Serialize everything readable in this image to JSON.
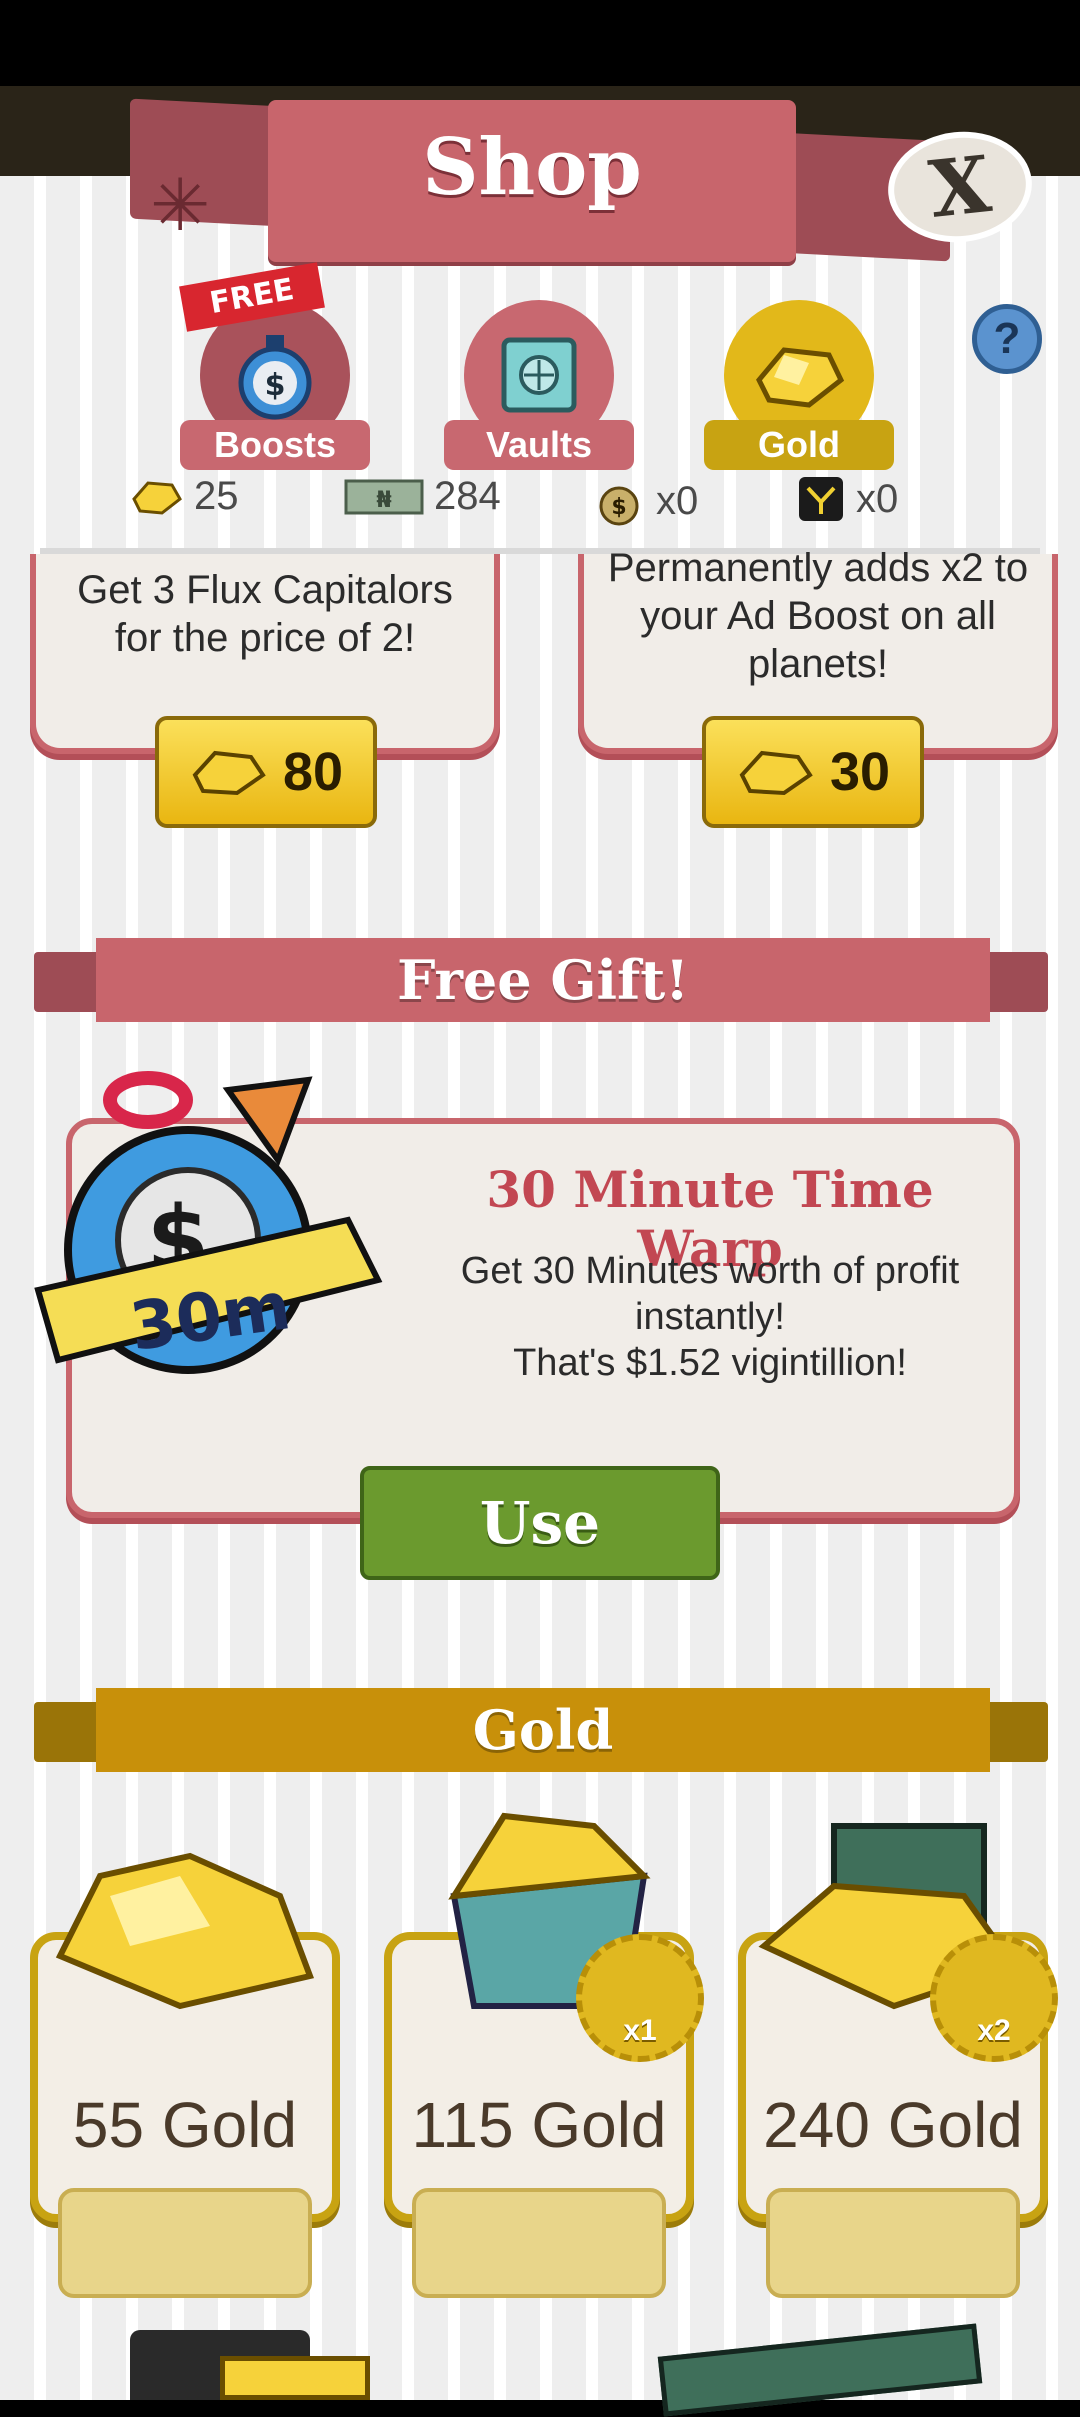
{
  "header": {
    "title": "Shop",
    "close_label": "X",
    "help_label": "?"
  },
  "tabs": [
    {
      "label": "Boosts",
      "badge": "FREE",
      "icon": "stopwatch-dollar-icon"
    },
    {
      "label": "Vaults",
      "icon": "vault-safe-icon"
    },
    {
      "label": "Gold",
      "icon": "gold-nugget-icon",
      "selected": true
    }
  ],
  "currencies": [
    {
      "icon": "gold-nugget-icon",
      "value": "25"
    },
    {
      "icon": "megabucks-bill-icon",
      "value": "284"
    },
    {
      "icon": "money-bag-icon",
      "value": "x0"
    },
    {
      "icon": "flux-capitalor-icon",
      "value": "x0"
    }
  ],
  "offers": [
    {
      "text": "Get 3 Flux Capitalors for the price of 2!",
      "price": "80"
    },
    {
      "text": "Permanently adds x2 to your Ad Boost on all planets!",
      "price": "30"
    }
  ],
  "free_gift": {
    "section_title": "Free Gift!",
    "badge": "30m",
    "title": "30 Minute Time Warp",
    "desc_line1": "Get 30 Minutes worth of profit instantly!",
    "desc_line2": "That's $1.52 vigintillion!",
    "button": "Use"
  },
  "gold_section": {
    "title": "Gold",
    "packs": [
      {
        "name": "55 Gold",
        "medal": ""
      },
      {
        "name": "115 Gold",
        "medal": "x1"
      },
      {
        "name": "240 Gold",
        "medal": "x2"
      }
    ]
  },
  "colors": {
    "shop_red": "#c8656c",
    "gold": "#c8a312",
    "use_green": "#6b9a2e"
  }
}
